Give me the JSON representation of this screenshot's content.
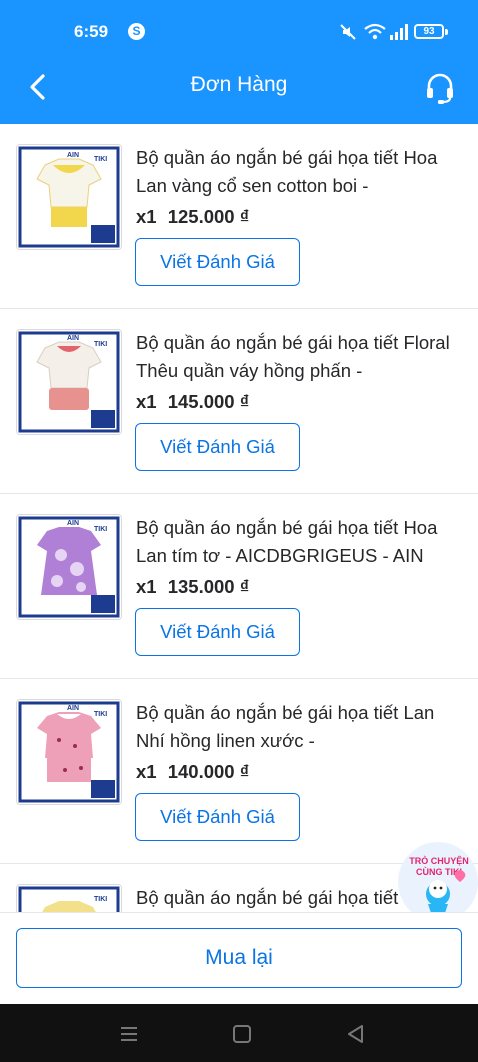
{
  "status_bar": {
    "time": "6:59",
    "app_icon": "S",
    "battery": "93"
  },
  "header": {
    "title": "Đơn Hàng",
    "back_icon": "chevron-left-icon",
    "support_icon": "headset-icon"
  },
  "orders": [
    {
      "name": "Bộ quần áo ngắn bé gái họa tiết Hoa Lan vàng cổ sen cotton boi -",
      "qty": "x1",
      "price": "125.000 ₫",
      "review_label": "Viết Đánh Giá",
      "thumb_color": "#f2d64b",
      "bottom_color": "#f2d64b"
    },
    {
      "name": "Bộ quần áo ngắn bé gái họa tiết Floral Thêu quần váy hồng phấn -",
      "qty": "x1",
      "price": "145.000 ₫",
      "review_label": "Viết Đánh Giá",
      "thumb_color": "#f4efe8",
      "bottom_color": "#e8928f"
    },
    {
      "name": "Bộ quần áo ngắn bé gái họa tiết Hoa Lan tím tơ - AICDBGRIGEUS - AIN",
      "qty": "x1",
      "price": "135.000 ₫",
      "review_label": "Viết Đánh Giá",
      "thumb_color": "#b07fd6",
      "bottom_color": "#b07fd6"
    },
    {
      "name": "Bộ quần áo ngắn bé gái họa tiết Lan Nhí hồng linen xước -",
      "qty": "x1",
      "price": "140.000 ₫",
      "review_label": "Viết Đánh Giá",
      "thumb_color": "#eea0b8",
      "bottom_color": "#eea0b8"
    },
    {
      "name": "Bộ quần áo ngắn bé gái họa tiết",
      "qty": "",
      "price": "",
      "review_label": "",
      "thumb_color": "#f2e18a",
      "bottom_color": "#f2e18a"
    }
  ],
  "chat_bubble": {
    "line1": "TRÒ CHUYỆN",
    "line2": "CÙNG TIKI"
  },
  "bottom": {
    "rebuy_label": "Mua lại"
  },
  "colors": {
    "header_bg": "#1a94ff",
    "accent": "#0b74e5"
  }
}
